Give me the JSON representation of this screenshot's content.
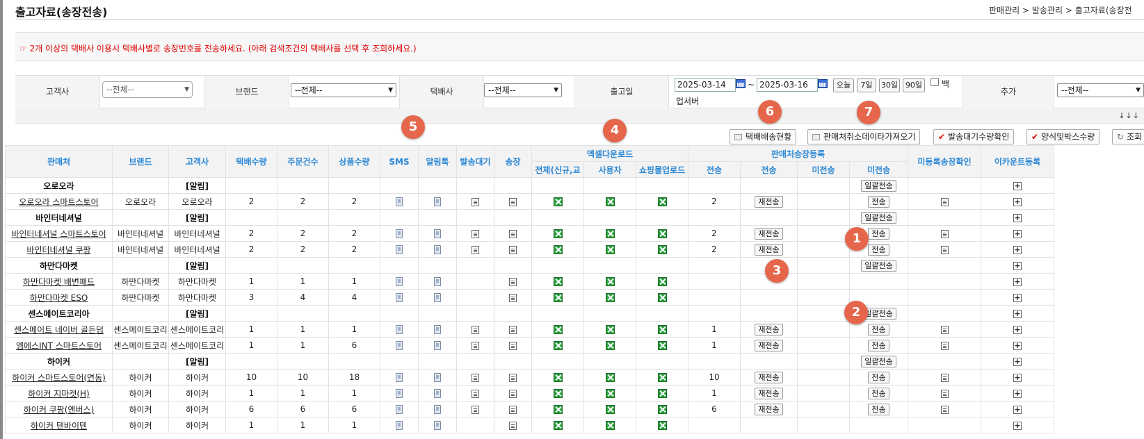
{
  "header": {
    "title": "출고자료(송장전송)",
    "breadcrumb": "판매관리 > 발송관리 > 출고자료(송장전"
  },
  "notice": "☞ 2개 이상의 택배사 이용시 택배사별로 송장번호를 전송하세요. (아래 검색조건의 택배사를 선택 후 조회하세요.)",
  "filters": {
    "customer_label": "고객사",
    "customer_value": "--전체--",
    "brand_label": "브랜드",
    "brand_value": "--전체--",
    "courier_label": "택배사",
    "courier_value": "--전체--",
    "ship_date_label": "출고일",
    "date_from": "2025-03-14",
    "date_to": "2025-03-16",
    "date_sep": "~",
    "quick_today": "오늘",
    "quick_7": "7일",
    "quick_30": "30일",
    "quick_90": "90일",
    "backup_label": "백",
    "backup_label_2": "업서버",
    "extra_label": "추가",
    "extra_value": "--전체--",
    "arrows": "↓↓↓"
  },
  "toolbar": {
    "courier_status": "택배배송현황",
    "fetch_cancel": "판매처취소데이타가져오기",
    "check_waiting": "발송대기수량확인",
    "form_box_qty": "양식및박스수량",
    "search": "조회"
  },
  "callouts": {
    "c1": "1",
    "c2": "2",
    "c3": "3",
    "c4": "4",
    "c5": "5",
    "c6": "6",
    "c7": "7"
  },
  "table": {
    "headers": {
      "seller": "판매처",
      "brand": "브랜드",
      "customer": "고객사",
      "parcel_qty": "택배수량",
      "order_cnt": "주문건수",
      "item_qty": "상품수량",
      "sms": "SMS",
      "alimtalk": "알림톡",
      "waiting": "발송대기",
      "invoice": "송장",
      "excel_group": "엑셀다운로드",
      "excel_all": "전체(신규,교",
      "excel_user": "사용자",
      "excel_mall": "쇼핑몰업로드",
      "reg_group": "판매처송장등록",
      "reg_sent": "전송",
      "reg_send": "전송",
      "reg_unsent": "미전송",
      "reg_unsent2": "미전송",
      "unreg_check": "미등록송장확인",
      "ecount": "이카운트등록"
    },
    "labels": {
      "alert": "[알림]",
      "bulk_send": "일괄전송",
      "resend": "재전송",
      "send": "전송"
    },
    "rows": [
      {
        "type": "group",
        "name": "오로오라"
      },
      {
        "type": "seller",
        "name": "오로오라 스마트스토어",
        "brand": "오로오라",
        "customer": "오로오라",
        "parcel": "2",
        "orders": "2",
        "items": "2",
        "sms": true,
        "alim": true,
        "wait": true,
        "sent": "2",
        "resend": true,
        "send": true,
        "unreg": true
      },
      {
        "type": "group",
        "name": "바인터네셔널"
      },
      {
        "type": "seller",
        "name": "바인터네셔널 스마트스토어",
        "brand": "바인터네셔널",
        "customer": "바인터네셔널",
        "parcel": "2",
        "orders": "2",
        "items": "2",
        "sms": true,
        "alim": true,
        "wait": true,
        "sent": "2",
        "resend": true,
        "send": true,
        "unreg": true
      },
      {
        "type": "seller",
        "name": "바인터네셔널 쿠팡",
        "brand": "바인터네셔널",
        "customer": "바인터네셔널",
        "parcel": "2",
        "orders": "2",
        "items": "2",
        "sms": true,
        "alim": true,
        "wait": true,
        "sent": "2",
        "resend": true,
        "send": true,
        "unreg": true
      },
      {
        "type": "group",
        "name": "하만다마켓"
      },
      {
        "type": "seller",
        "name": "하만다마켓 배변패드",
        "brand": "하만다마켓",
        "customer": "하만다마켓",
        "parcel": "1",
        "orders": "1",
        "items": "1",
        "sms": true,
        "alim": true,
        "wait": false,
        "sent": "",
        "resend": false,
        "send": false,
        "unreg": false
      },
      {
        "type": "seller",
        "name": "하만다마켓 ESO",
        "brand": "하만다마켓",
        "customer": "하만다마켓",
        "parcel": "3",
        "orders": "4",
        "items": "4",
        "sms": true,
        "alim": true,
        "wait": false,
        "sent": "",
        "resend": false,
        "send": false,
        "unreg": false
      },
      {
        "type": "group",
        "name": "센스메이트코리아"
      },
      {
        "type": "seller",
        "name": "센스메이트 네이버 골든덤",
        "brand": "센스메이트코리",
        "customer": "센스메이트코리",
        "parcel": "1",
        "orders": "1",
        "items": "1",
        "sms": true,
        "alim": true,
        "wait": true,
        "sent": "1",
        "resend": true,
        "send": true,
        "unreg": true
      },
      {
        "type": "seller",
        "name": "엠에스INT 스마트스토어",
        "brand": "센스메이트코리",
        "customer": "센스메이트코리",
        "parcel": "1",
        "orders": "1",
        "items": "6",
        "sms": true,
        "alim": true,
        "wait": true,
        "sent": "1",
        "resend": true,
        "send": true,
        "unreg": true
      },
      {
        "type": "group",
        "name": "하이커"
      },
      {
        "type": "seller",
        "name": "하이커 스마트스토어(연동)",
        "brand": "하이커",
        "customer": "하이커",
        "parcel": "10",
        "orders": "10",
        "items": "18",
        "sms": true,
        "alim": true,
        "wait": true,
        "sent": "10",
        "resend": true,
        "send": true,
        "unreg": true
      },
      {
        "type": "seller",
        "name": "하이커 지마켓(H)",
        "brand": "하이커",
        "customer": "하이커",
        "parcel": "1",
        "orders": "1",
        "items": "1",
        "sms": true,
        "alim": true,
        "wait": true,
        "sent": "1",
        "resend": true,
        "send": true,
        "unreg": true
      },
      {
        "type": "seller",
        "name": "하이커 쿠팡(엔버스)",
        "brand": "하이커",
        "customer": "하이커",
        "parcel": "6",
        "orders": "6",
        "items": "6",
        "sms": true,
        "alim": true,
        "wait": true,
        "sent": "6",
        "resend": true,
        "send": true,
        "unreg": true
      },
      {
        "type": "seller",
        "name": "하이커 텐바이텐",
        "brand": "하이커",
        "customer": "하이커",
        "parcel": "1",
        "orders": "1",
        "items": "1",
        "sms": true,
        "alim": true,
        "wait": false,
        "sent": "",
        "resend": false,
        "send": false,
        "unreg": false
      }
    ]
  }
}
